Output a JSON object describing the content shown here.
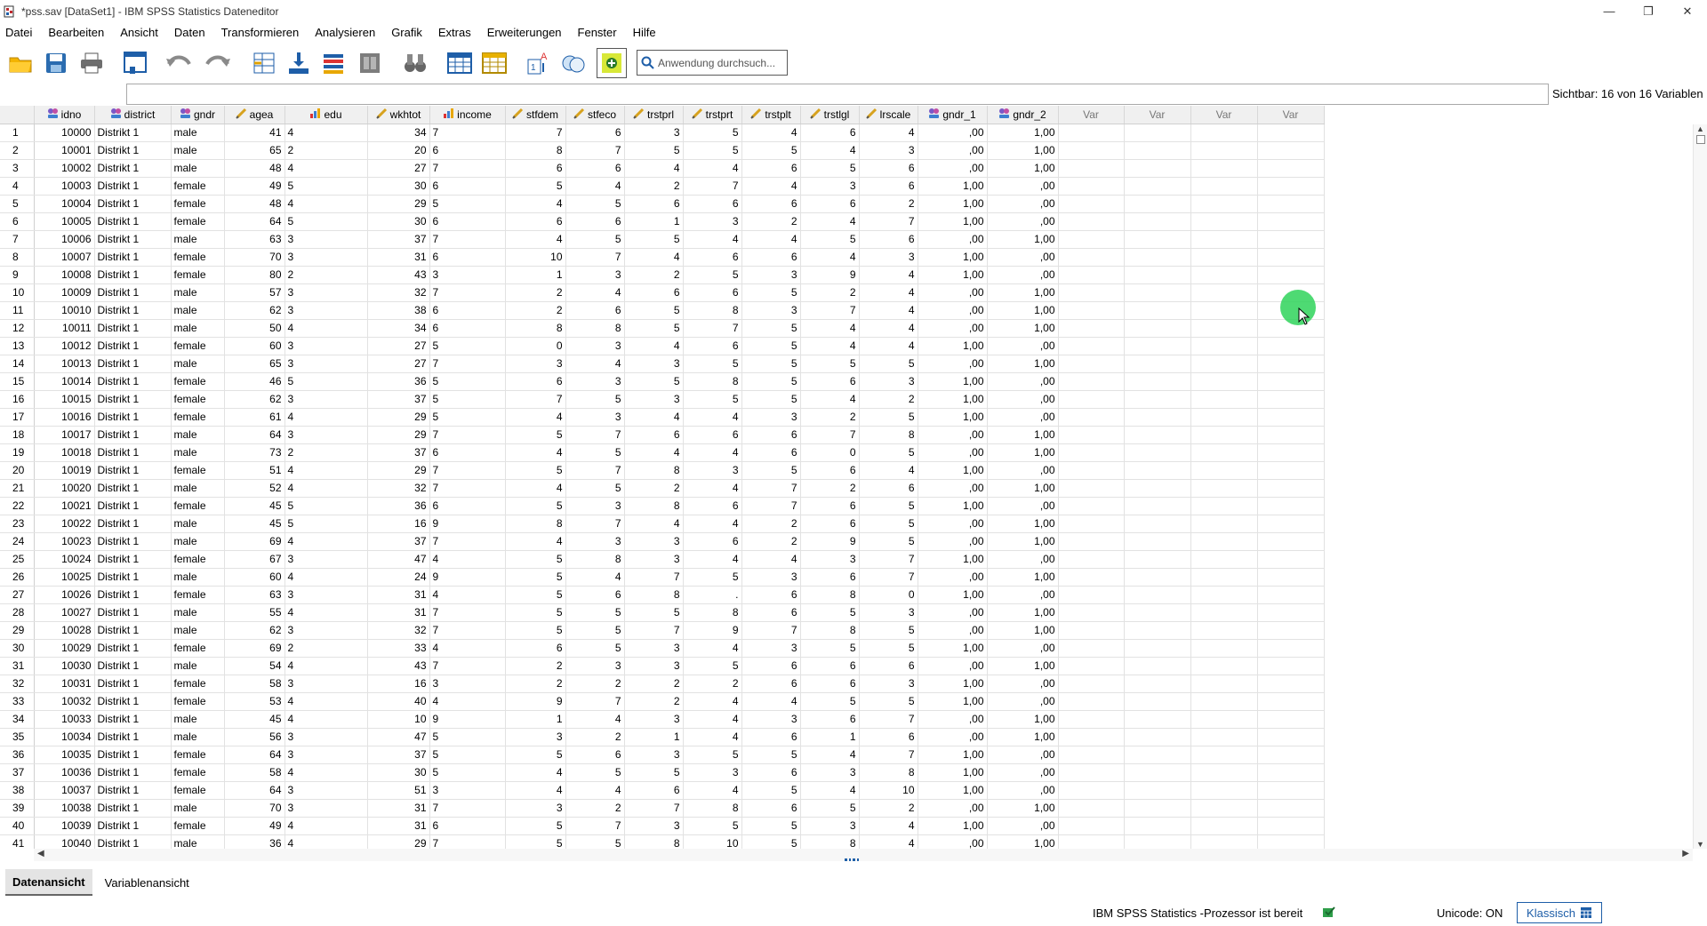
{
  "window": {
    "title": "*pss.sav [DataSet1] - IBM SPSS Statistics Dateneditor",
    "minimize_glyph": "—",
    "restore_glyph": "❐",
    "close_glyph": "✕"
  },
  "menu": [
    "Datei",
    "Bearbeiten",
    "Ansicht",
    "Daten",
    "Transformieren",
    "Analysieren",
    "Grafik",
    "Extras",
    "Erweiterungen",
    "Fenster",
    "Hilfe"
  ],
  "toolbar": {
    "icons": [
      "open-folder-icon",
      "save-icon",
      "print-icon",
      "recall-dialog-icon",
      "undo-icon",
      "redo-icon",
      "goto-case-icon",
      "goto-variable-icon",
      "variables-icon",
      "run-descriptives-icon",
      "find-icon",
      "insert-cases-icon",
      "insert-variable-icon",
      "split-file-icon",
      "weight-cases-icon",
      "select-cases-icon",
      "value-labels-icon",
      "use-sets-icon"
    ],
    "search_placeholder": "Anwendung durchsuch..."
  },
  "cell_editor": {
    "value": ""
  },
  "visible_vars": "Sichtbar: 16 von 16 Variablen",
  "columns": [
    {
      "name": "idno",
      "icon": "nominal-icon",
      "align": "num"
    },
    {
      "name": "district",
      "icon": "nominal-icon",
      "align": "str"
    },
    {
      "name": "gndr",
      "icon": "nominal-icon",
      "align": "str"
    },
    {
      "name": "agea",
      "icon": "scale-icon",
      "align": "num"
    },
    {
      "name": "edu",
      "icon": "ordinal-icon",
      "align": "str"
    },
    {
      "name": "wkhtot",
      "icon": "scale-icon",
      "align": "num"
    },
    {
      "name": "income",
      "icon": "ordinal-icon",
      "align": "str"
    },
    {
      "name": "stfdem",
      "icon": "scale-icon",
      "align": "num"
    },
    {
      "name": "stfeco",
      "icon": "scale-icon",
      "align": "num"
    },
    {
      "name": "trstprl",
      "icon": "scale-icon",
      "align": "num"
    },
    {
      "name": "trstprt",
      "icon": "scale-icon",
      "align": "num"
    },
    {
      "name": "trstplt",
      "icon": "scale-icon",
      "align": "num"
    },
    {
      "name": "trstlgl",
      "icon": "scale-icon",
      "align": "num"
    },
    {
      "name": "lrscale",
      "icon": "scale-icon",
      "align": "num"
    },
    {
      "name": "gndr_1",
      "icon": "nominal-icon",
      "align": "num"
    },
    {
      "name": "gndr_2",
      "icon": "nominal-icon",
      "align": "num"
    },
    {
      "name": "Var",
      "icon": "",
      "align": "num"
    },
    {
      "name": "Var",
      "icon": "",
      "align": "num"
    },
    {
      "name": "Var",
      "icon": "",
      "align": "num"
    },
    {
      "name": "Var",
      "icon": "",
      "align": "num"
    }
  ],
  "rows": [
    [
      "10000",
      "Distrikt 1",
      "male",
      "41",
      "4",
      "34",
      "7",
      "7",
      "6",
      "3",
      "5",
      "4",
      "6",
      "4",
      ",00",
      "1,00"
    ],
    [
      "10001",
      "Distrikt 1",
      "male",
      "65",
      "2",
      "20",
      "6",
      "8",
      "7",
      "5",
      "5",
      "5",
      "4",
      "3",
      ",00",
      "1,00"
    ],
    [
      "10002",
      "Distrikt 1",
      "male",
      "48",
      "4",
      "27",
      "7",
      "6",
      "6",
      "4",
      "4",
      "6",
      "5",
      "6",
      ",00",
      "1,00"
    ],
    [
      "10003",
      "Distrikt 1",
      "female",
      "49",
      "5",
      "30",
      "6",
      "5",
      "4",
      "2",
      "7",
      "4",
      "3",
      "6",
      "1,00",
      ",00"
    ],
    [
      "10004",
      "Distrikt 1",
      "female",
      "48",
      "4",
      "29",
      "5",
      "4",
      "5",
      "6",
      "6",
      "6",
      "6",
      "2",
      "1,00",
      ",00"
    ],
    [
      "10005",
      "Distrikt 1",
      "female",
      "64",
      "5",
      "30",
      "6",
      "6",
      "6",
      "1",
      "3",
      "2",
      "4",
      "7",
      "1,00",
      ",00"
    ],
    [
      "10006",
      "Distrikt 1",
      "male",
      "63",
      "3",
      "37",
      "7",
      "4",
      "5",
      "5",
      "4",
      "4",
      "5",
      "6",
      ",00",
      "1,00"
    ],
    [
      "10007",
      "Distrikt 1",
      "female",
      "70",
      "3",
      "31",
      "6",
      "10",
      "7",
      "4",
      "6",
      "6",
      "4",
      "3",
      "1,00",
      ",00"
    ],
    [
      "10008",
      "Distrikt 1",
      "female",
      "80",
      "2",
      "43",
      "3",
      "1",
      "3",
      "2",
      "5",
      "3",
      "9",
      "4",
      "1,00",
      ",00"
    ],
    [
      "10009",
      "Distrikt 1",
      "male",
      "57",
      "3",
      "32",
      "7",
      "2",
      "4",
      "6",
      "6",
      "5",
      "2",
      "4",
      ",00",
      "1,00"
    ],
    [
      "10010",
      "Distrikt 1",
      "male",
      "62",
      "3",
      "38",
      "6",
      "2",
      "6",
      "5",
      "8",
      "3",
      "7",
      "4",
      ",00",
      "1,00"
    ],
    [
      "10011",
      "Distrikt 1",
      "male",
      "50",
      "4",
      "34",
      "6",
      "8",
      "8",
      "5",
      "7",
      "5",
      "4",
      "4",
      ",00",
      "1,00"
    ],
    [
      "10012",
      "Distrikt 1",
      "female",
      "60",
      "3",
      "27",
      "5",
      "0",
      "3",
      "4",
      "6",
      "5",
      "4",
      "4",
      "1,00",
      ",00"
    ],
    [
      "10013",
      "Distrikt 1",
      "male",
      "65",
      "3",
      "27",
      "7",
      "3",
      "4",
      "3",
      "5",
      "5",
      "5",
      "5",
      ",00",
      "1,00"
    ],
    [
      "10014",
      "Distrikt 1",
      "female",
      "46",
      "5",
      "36",
      "5",
      "6",
      "3",
      "5",
      "8",
      "5",
      "6",
      "3",
      "1,00",
      ",00"
    ],
    [
      "10015",
      "Distrikt 1",
      "female",
      "62",
      "3",
      "37",
      "5",
      "7",
      "5",
      "3",
      "5",
      "5",
      "4",
      "2",
      "1,00",
      ",00"
    ],
    [
      "10016",
      "Distrikt 1",
      "female",
      "61",
      "4",
      "29",
      "5",
      "4",
      "3",
      "4",
      "4",
      "3",
      "2",
      "5",
      "1,00",
      ",00"
    ],
    [
      "10017",
      "Distrikt 1",
      "male",
      "64",
      "3",
      "29",
      "7",
      "5",
      "7",
      "6",
      "6",
      "6",
      "7",
      "8",
      ",00",
      "1,00"
    ],
    [
      "10018",
      "Distrikt 1",
      "male",
      "73",
      "2",
      "37",
      "6",
      "4",
      "5",
      "4",
      "4",
      "6",
      "0",
      "5",
      ",00",
      "1,00"
    ],
    [
      "10019",
      "Distrikt 1",
      "female",
      "51",
      "4",
      "29",
      "7",
      "5",
      "7",
      "8",
      "3",
      "5",
      "6",
      "4",
      "1,00",
      ",00"
    ],
    [
      "10020",
      "Distrikt 1",
      "male",
      "52",
      "4",
      "32",
      "7",
      "4",
      "5",
      "2",
      "4",
      "7",
      "2",
      "6",
      ",00",
      "1,00"
    ],
    [
      "10021",
      "Distrikt 1",
      "female",
      "45",
      "5",
      "36",
      "6",
      "5",
      "3",
      "8",
      "6",
      "7",
      "6",
      "5",
      "1,00",
      ",00"
    ],
    [
      "10022",
      "Distrikt 1",
      "male",
      "45",
      "5",
      "16",
      "9",
      "8",
      "7",
      "4",
      "4",
      "2",
      "6",
      "5",
      ",00",
      "1,00"
    ],
    [
      "10023",
      "Distrikt 1",
      "male",
      "69",
      "4",
      "37",
      "7",
      "4",
      "3",
      "3",
      "6",
      "2",
      "9",
      "5",
      ",00",
      "1,00"
    ],
    [
      "10024",
      "Distrikt 1",
      "female",
      "67",
      "3",
      "47",
      "4",
      "5",
      "8",
      "3",
      "4",
      "4",
      "3",
      "7",
      "1,00",
      ",00"
    ],
    [
      "10025",
      "Distrikt 1",
      "male",
      "60",
      "4",
      "24",
      "9",
      "5",
      "4",
      "7",
      "5",
      "3",
      "6",
      "7",
      ",00",
      "1,00"
    ],
    [
      "10026",
      "Distrikt 1",
      "female",
      "63",
      "3",
      "31",
      "4",
      "5",
      "6",
      "8",
      ".",
      "6",
      "8",
      "0",
      "1,00",
      ",00"
    ],
    [
      "10027",
      "Distrikt 1",
      "male",
      "55",
      "4",
      "31",
      "7",
      "5",
      "5",
      "5",
      "8",
      "6",
      "5",
      "3",
      ",00",
      "1,00"
    ],
    [
      "10028",
      "Distrikt 1",
      "male",
      "62",
      "3",
      "32",
      "7",
      "5",
      "5",
      "7",
      "9",
      "7",
      "8",
      "5",
      ",00",
      "1,00"
    ],
    [
      "10029",
      "Distrikt 1",
      "female",
      "69",
      "2",
      "33",
      "4",
      "6",
      "5",
      "3",
      "4",
      "3",
      "5",
      "5",
      "1,00",
      ",00"
    ],
    [
      "10030",
      "Distrikt 1",
      "male",
      "54",
      "4",
      "43",
      "7",
      "2",
      "3",
      "3",
      "5",
      "6",
      "6",
      "6",
      ",00",
      "1,00"
    ],
    [
      "10031",
      "Distrikt 1",
      "female",
      "58",
      "3",
      "16",
      "3",
      "2",
      "2",
      "2",
      "2",
      "6",
      "6",
      "3",
      "1,00",
      ",00"
    ],
    [
      "10032",
      "Distrikt 1",
      "female",
      "53",
      "4",
      "40",
      "4",
      "9",
      "7",
      "2",
      "4",
      "4",
      "5",
      "5",
      "1,00",
      ",00"
    ],
    [
      "10033",
      "Distrikt 1",
      "male",
      "45",
      "4",
      "10",
      "9",
      "1",
      "4",
      "3",
      "4",
      "3",
      "6",
      "7",
      ",00",
      "1,00"
    ],
    [
      "10034",
      "Distrikt 1",
      "male",
      "56",
      "3",
      "47",
      "5",
      "3",
      "2",
      "1",
      "4",
      "6",
      "1",
      "6",
      ",00",
      "1,00"
    ],
    [
      "10035",
      "Distrikt 1",
      "female",
      "64",
      "3",
      "37",
      "5",
      "5",
      "6",
      "3",
      "5",
      "5",
      "4",
      "7",
      "1,00",
      ",00"
    ],
    [
      "10036",
      "Distrikt 1",
      "female",
      "58",
      "4",
      "30",
      "5",
      "4",
      "5",
      "5",
      "3",
      "6",
      "3",
      "8",
      "1,00",
      ",00"
    ],
    [
      "10037",
      "Distrikt 1",
      "female",
      "64",
      "3",
      "51",
      "3",
      "4",
      "4",
      "6",
      "4",
      "5",
      "4",
      "10",
      "1,00",
      ",00"
    ],
    [
      "10038",
      "Distrikt 1",
      "male",
      "70",
      "3",
      "31",
      "7",
      "3",
      "2",
      "7",
      "8",
      "6",
      "5",
      "2",
      ",00",
      "1,00"
    ],
    [
      "10039",
      "Distrikt 1",
      "female",
      "49",
      "4",
      "31",
      "6",
      "5",
      "7",
      "3",
      "5",
      "5",
      "3",
      "4",
      "1,00",
      ",00"
    ],
    [
      "10040",
      "Distrikt 1",
      "male",
      "36",
      "4",
      "29",
      "7",
      "5",
      "5",
      "8",
      "10",
      "5",
      "8",
      "4",
      ",00",
      "1,00"
    ]
  ],
  "tabs": {
    "data_view": "Datenansicht",
    "variable_view": "Variablenansicht"
  },
  "status": {
    "processor": "IBM SPSS Statistics -Prozessor ist bereit",
    "unicode": "Unicode: ON",
    "mode": "Klassisch"
  },
  "colors": {
    "accent": "#1e5ea8",
    "cursor": "#2fd35b",
    "nominal_icon": "#7b59c7",
    "scale_icon": "#d7a21e"
  }
}
